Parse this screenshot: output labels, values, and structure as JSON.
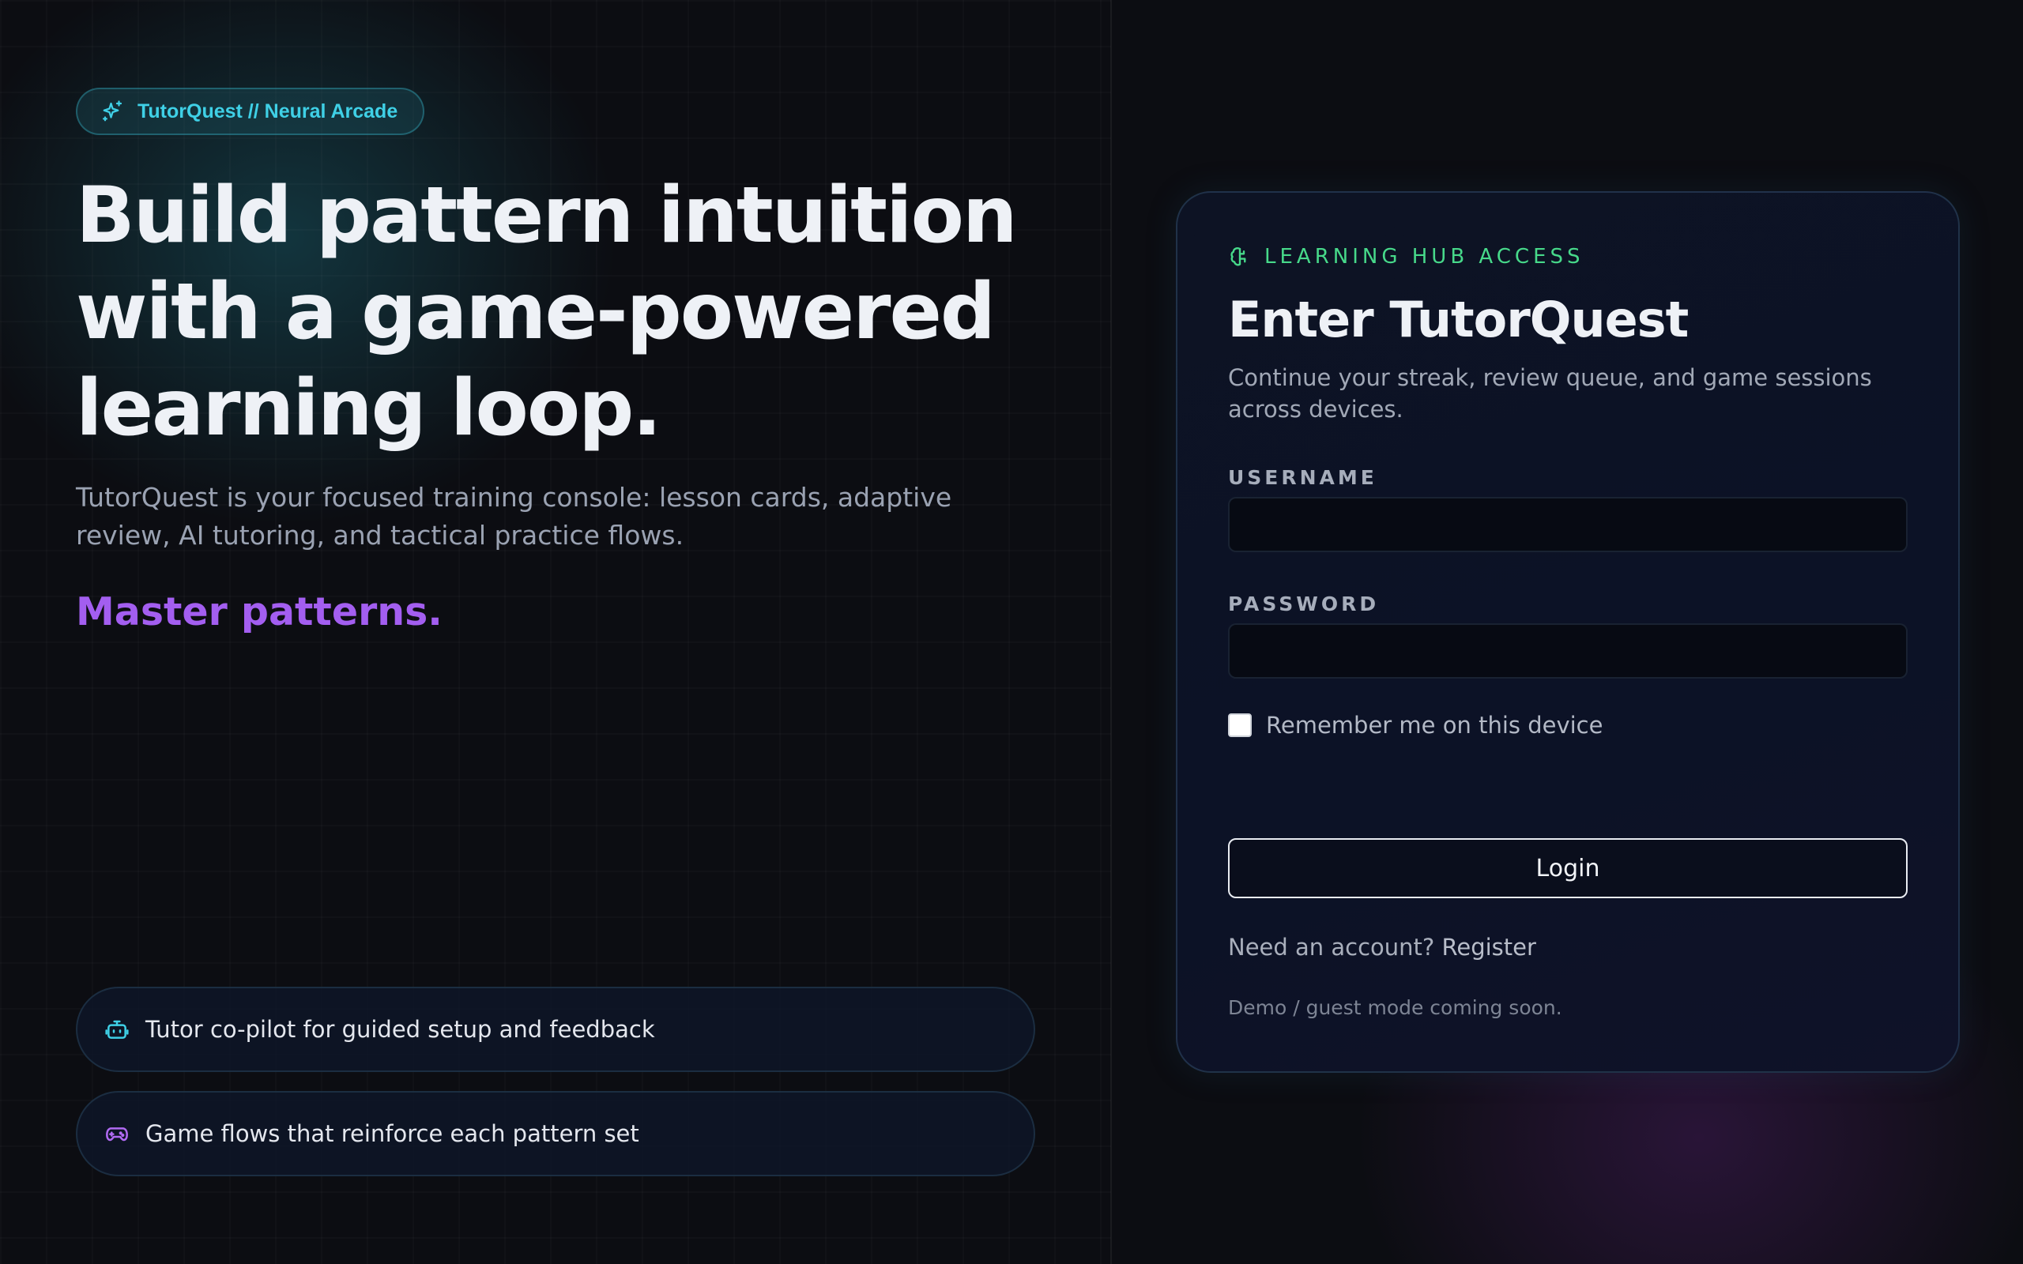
{
  "brand": {
    "badge_label": "TutorQuest // Neural Arcade"
  },
  "hero": {
    "title_line_1": "Build pattern intuition",
    "title_line_2": "with a game-powered",
    "title_line_3": "learning loop.",
    "subtitle": "TutorQuest is your focused training console: lesson cards, adaptive review, AI tutoring, and tactical practice flows.",
    "tagline": "Master patterns."
  },
  "features": [
    {
      "label": "Tutor co-pilot for guided setup and feedback",
      "icon": "robot-icon"
    },
    {
      "label": "Game flows that reinforce each pattern set",
      "icon": "gamepad-icon"
    }
  ],
  "login": {
    "kicker": "LEARNING HUB ACCESS",
    "kicker_icon": "brain-icon",
    "title": "Enter TutorQuest",
    "subtitle": "Continue your streak, review queue, and game sessions across devices.",
    "username_label": "USERNAME",
    "username_value": "",
    "password_label": "PASSWORD",
    "password_value": "",
    "remember_label": "Remember me on this device",
    "remember_checked": false,
    "submit_label": "Login",
    "register_prompt": "Need an account?",
    "register_link": "Register",
    "demo_note": "Demo / guest mode coming soon."
  },
  "colors": {
    "accent_cyan": "#3fd0e6",
    "accent_green": "#47d98a",
    "accent_purple": "#a35ef0",
    "background": "#0c0d12"
  }
}
